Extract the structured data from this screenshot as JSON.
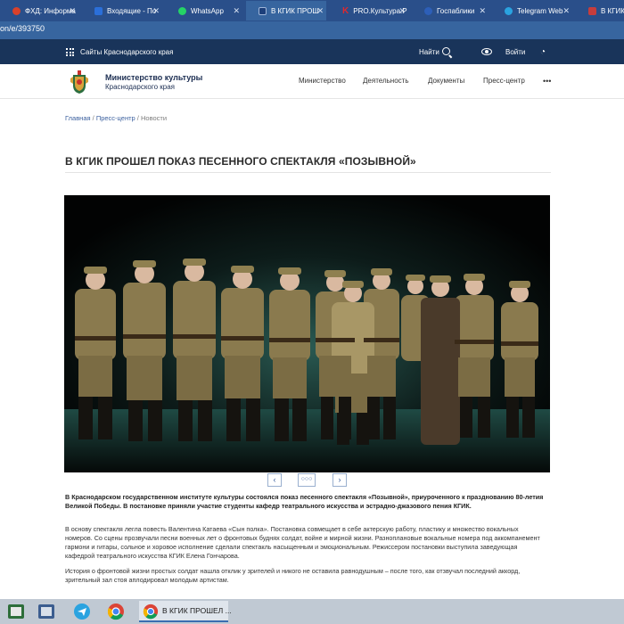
{
  "browser": {
    "tabs": [
      {
        "label": "ФХД: Информа",
        "favicon_color": "#d9412b"
      },
      {
        "label": "Входящие - По",
        "favicon_color": "#2b6fd9"
      },
      {
        "label": "WhatsApp",
        "favicon_color": "#25d366"
      },
      {
        "label": "В КГИК ПРОШ",
        "favicon_color": "#1c3f7a"
      },
      {
        "label": "PRO.Культура.Р",
        "favicon_color": "#e0282e"
      },
      {
        "label": "Госпаблики",
        "favicon_color": "#2d5fb8"
      },
      {
        "label": "Telegram Web",
        "favicon_color": "#2aa3e0"
      },
      {
        "label": "В КГИК пр",
        "favicon_color": "#c63d3d"
      }
    ],
    "url": "on/e/393750"
  },
  "site_top": {
    "sites_label": "Сайты Краснодарского края",
    "find_label": "Найти",
    "login_label": "Войти"
  },
  "header": {
    "ministry_title": "Министерство культуры",
    "ministry_subtitle": "Краснодарского края",
    "nav": [
      "Министерство",
      "Деятельность",
      "Документы",
      "Пресс-центр"
    ],
    "more": "•••"
  },
  "breadcrumb": {
    "home": "Главная",
    "section": "Пресс-центр",
    "current": "Новости",
    "sep": "/"
  },
  "article": {
    "title": "В КГИК ПРОШЕЛ ПОКАЗ ПЕСЕННОГО СПЕКТАКЛЯ «ПОЗЫВНОЙ»",
    "gallery": {
      "prev": "‹",
      "dots": "○○○",
      "next": "›"
    },
    "lead": "В Краснодарском государственном институте культуры состоялся показ песенного спектакля «Позывной», приуроченного к празднованию 80-летия Великой Победы. В постановке приняли участие студенты кафедр театрального искусства и эстрадно-джазового пения КГИК.",
    "p1": "В основу спектакля легла повесть Валентина Катаева «Сын полка». Постановка совмещает в себе актерскую работу, пластику и множество вокальных номеров. Со сцены прозвучали песни военных лет о фронтовых буднях солдат, войне и мирной жизни. Разноплановые вокальные номера под аккомпанемент гармони и гитары, сольное и хоровое исполнение сделали спектакль насыщенным и эмоциональным. Режиссером постановки выступила заведующая кафедрой театрального искусства КГИК Елена Гончарова.",
    "p2": "История о фронтовой жизни простых солдат нашла отклик у зрителей и никого не оставила равнодушным – после того, как отзвучал последний аккорд, зрительный зал стоя аплодировал молодым артистам."
  },
  "taskbar": {
    "active_label": "В КГИК ПРОШЕЛ ..."
  }
}
